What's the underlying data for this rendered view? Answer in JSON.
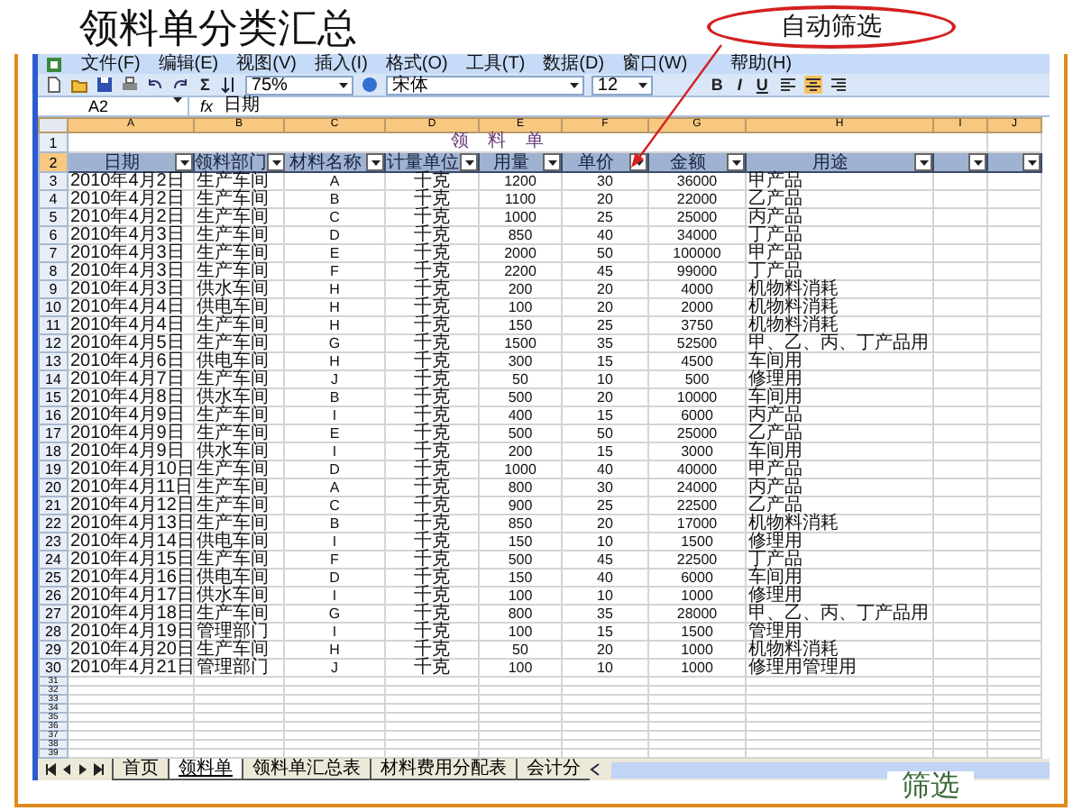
{
  "slide": {
    "title": "领料单分类汇总",
    "callout": "自动筛选",
    "footer": "筛选"
  },
  "menu": [
    "文件(F)",
    "编辑(E)",
    "视图(V)",
    "插入(I)",
    "格式(O)",
    "工具(T)",
    "数据(D)",
    "窗口(W)",
    "帮助(H)"
  ],
  "toolbar": {
    "sum": "Σ",
    "zoom": "75%",
    "font": "宋体",
    "size": "12",
    "bold": "B",
    "italic": "I",
    "underline": "U"
  },
  "formula_bar": {
    "cell": "A2",
    "fx": "fx",
    "value": "日期"
  },
  "sheet": {
    "columns": [
      {
        "label": "A",
        "selected": true
      },
      {
        "label": "B",
        "selected": true
      },
      {
        "label": "C",
        "selected": true
      },
      {
        "label": "D",
        "selected": true
      },
      {
        "label": "E",
        "selected": true
      },
      {
        "label": "F",
        "selected": true
      },
      {
        "label": "G",
        "selected": true
      },
      {
        "label": "H",
        "selected": true
      },
      {
        "label": "I",
        "selected": true
      },
      {
        "label": "J",
        "selected": true
      }
    ],
    "title_row": {
      "n": "1",
      "text": "领 料 单"
    },
    "header_row": {
      "n": "2",
      "selected": true,
      "headers": [
        "日期",
        "领料部门",
        "材料名称",
        "计量单位",
        "用量",
        "单价",
        "金额",
        "用途"
      ]
    },
    "rows": [
      {
        "n": "3",
        "cells": [
          "2010年4月2日",
          "生产车间",
          "A",
          "千克",
          "1200",
          "30",
          "36000",
          "甲产品"
        ]
      },
      {
        "n": "4",
        "cells": [
          "2010年4月2日",
          "生产车间",
          "B",
          "千克",
          "1100",
          "20",
          "22000",
          "乙产品"
        ]
      },
      {
        "n": "5",
        "cells": [
          "2010年4月2日",
          "生产车间",
          "C",
          "千克",
          "1000",
          "25",
          "25000",
          "丙产品"
        ]
      },
      {
        "n": "6",
        "cells": [
          "2010年4月3日",
          "生产车间",
          "D",
          "千克",
          "850",
          "40",
          "34000",
          "丁产品"
        ]
      },
      {
        "n": "7",
        "cells": [
          "2010年4月3日",
          "生产车间",
          "E",
          "千克",
          "2000",
          "50",
          "100000",
          "甲产品"
        ]
      },
      {
        "n": "8",
        "cells": [
          "2010年4月3日",
          "生产车间",
          "F",
          "千克",
          "2200",
          "45",
          "99000",
          "丁产品"
        ]
      },
      {
        "n": "9",
        "cells": [
          "2010年4月3日",
          "供水车间",
          "H",
          "千克",
          "200",
          "20",
          "4000",
          "机物料消耗"
        ]
      },
      {
        "n": "10",
        "cells": [
          "2010年4月4日",
          "供电车间",
          "H",
          "千克",
          "100",
          "20",
          "2000",
          "机物料消耗"
        ]
      },
      {
        "n": "11",
        "cells": [
          "2010年4月4日",
          "生产车间",
          "H",
          "千克",
          "150",
          "25",
          "3750",
          "机物料消耗"
        ]
      },
      {
        "n": "12",
        "cells": [
          "2010年4月5日",
          "生产车间",
          "G",
          "千克",
          "1500",
          "35",
          "52500",
          "甲、乙、丙、丁产品用"
        ]
      },
      {
        "n": "13",
        "cells": [
          "2010年4月6日",
          "供电车间",
          "H",
          "千克",
          "300",
          "15",
          "4500",
          "车间用"
        ]
      },
      {
        "n": "14",
        "cells": [
          "2010年4月7日",
          "生产车间",
          "J",
          "千克",
          "50",
          "10",
          "500",
          "修理用"
        ]
      },
      {
        "n": "15",
        "cells": [
          "2010年4月8日",
          "供水车间",
          "B",
          "千克",
          "500",
          "20",
          "10000",
          "车间用"
        ]
      },
      {
        "n": "16",
        "cells": [
          "2010年4月9日",
          "生产车间",
          "I",
          "千克",
          "400",
          "15",
          "6000",
          "丙产品"
        ]
      },
      {
        "n": "17",
        "cells": [
          "2010年4月9日",
          "生产车间",
          "E",
          "千克",
          "500",
          "50",
          "25000",
          "乙产品"
        ]
      },
      {
        "n": "18",
        "cells": [
          "2010年4月9日",
          "供水车间",
          "I",
          "千克",
          "200",
          "15",
          "3000",
          "车间用"
        ]
      },
      {
        "n": "19",
        "cells": [
          "2010年4月10日",
          "生产车间",
          "D",
          "千克",
          "1000",
          "40",
          "40000",
          "甲产品"
        ]
      },
      {
        "n": "20",
        "cells": [
          "2010年4月11日",
          "生产车间",
          "A",
          "千克",
          "800",
          "30",
          "24000",
          "丙产品"
        ]
      },
      {
        "n": "21",
        "cells": [
          "2010年4月12日",
          "生产车间",
          "C",
          "千克",
          "900",
          "25",
          "22500",
          "乙产品"
        ]
      },
      {
        "n": "22",
        "cells": [
          "2010年4月13日",
          "生产车间",
          "B",
          "千克",
          "850",
          "20",
          "17000",
          "机物料消耗"
        ]
      },
      {
        "n": "23",
        "cells": [
          "2010年4月14日",
          "供电车间",
          "I",
          "千克",
          "150",
          "10",
          "1500",
          "修理用"
        ]
      },
      {
        "n": "24",
        "cells": [
          "2010年4月15日",
          "生产车间",
          "F",
          "千克",
          "500",
          "45",
          "22500",
          "丁产品"
        ]
      },
      {
        "n": "25",
        "cells": [
          "2010年4月16日",
          "供电车间",
          "D",
          "千克",
          "150",
          "40",
          "6000",
          "车间用"
        ]
      },
      {
        "n": "26",
        "cells": [
          "2010年4月17日",
          "供水车间",
          "I",
          "千克",
          "100",
          "10",
          "1000",
          "修理用"
        ]
      },
      {
        "n": "27",
        "cells": [
          "2010年4月18日",
          "生产车间",
          "G",
          "千克",
          "800",
          "35",
          "28000",
          "甲、乙、丙、丁产品用"
        ]
      },
      {
        "n": "28",
        "cells": [
          "2010年4月19日",
          "管理部门",
          "I",
          "千克",
          "100",
          "15",
          "1500",
          "管理用"
        ]
      },
      {
        "n": "29",
        "cells": [
          "2010年4月20日",
          "生产车间",
          "H",
          "千克",
          "50",
          "20",
          "1000",
          "机物料消耗"
        ]
      },
      {
        "n": "30",
        "cells": [
          "2010年4月21日",
          "管理部门",
          "J",
          "千克",
          "100",
          "10",
          "1000",
          "修理用管理用"
        ]
      }
    ],
    "empty_rows": [
      "31",
      "32",
      "33",
      "34",
      "35",
      "36",
      "37",
      "38",
      "39"
    ]
  },
  "tabs": [
    {
      "label": "首页",
      "selected": false
    },
    {
      "label": "领料单",
      "selected": true
    },
    {
      "label": "领料单汇总表",
      "selected": false
    },
    {
      "label": "材料费用分配表",
      "selected": false
    },
    {
      "label": "会计分",
      "selected": false
    }
  ]
}
